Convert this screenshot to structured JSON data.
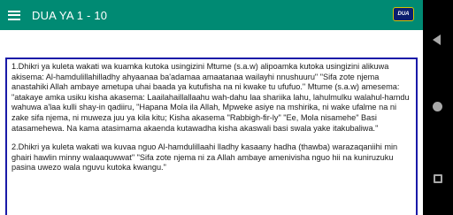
{
  "toolbar": {
    "title": "DUA YA 1 - 10",
    "logo_text": "DUA",
    "menu_icon": "hamburger-menu-icon"
  },
  "content": {
    "paragraphs": [
      "1.Dhikri ya kuleta wakati wa kuamka kutoka usingizini Mtume (s.a.w) alipoamka kutoka usingizini alikuwa akisema: Al-hamdulillahilladhy ahyaanaa ba'adamaa amaatanaa wailayhi nnushuuru\" \"Sifa zote njema anastahiki Allah ambaye ametupa uhai baada ya kutufisha na ni kwake tu ufufuo.\" Mtume (s.a.w) amesema: \"atakaye amka usiku kisha akasema: Laailahaillallaahu wah-dahu laa shariika lahu, lahulmulku walahul-hamdu wahuwa a'laa kulli shay-in qadiiru, \"Hapana Mola ila Allah, Mpweke asiye na mshirika, ni wake ufalme na ni zake sifa njema, ni muweza juu ya kila kitu; Kisha akasema \"Rabbigh-fir-ly\" \"Ee, Mola nisamehe\" Basi atasamehewa. Na kama atasimama akaenda kutawadha kisha akaswali basi swala yake itakubaliwa.\"",
      "2.Dhikri ya kuleta wakati wa kuvaa nguo Al-hamdulillaahi lladhy kasaany hadha (thawba) warazaqaniihi min ghairi hawlin minny walaaquwwat\" \"Sifa zote njema ni za Allah ambaye amenivisha nguo hii na kuniruzuku pasina uwezo wala nguvu kutoka kwangu.\""
    ]
  },
  "colors": {
    "toolbar": "#008a73",
    "content_border": "#1a1aa8",
    "nav_bar": "#000000"
  },
  "nav": {
    "back_icon": "back-triangle-icon",
    "home_icon": "home-circle-icon",
    "recent_icon": "recent-apps-square-icon"
  }
}
